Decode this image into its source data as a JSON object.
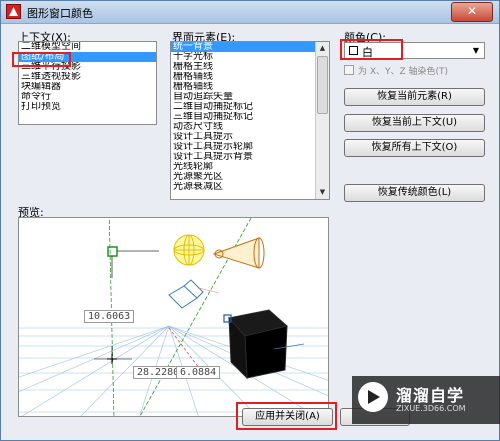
{
  "window": {
    "title": "图形窗口颜色",
    "close_label": "✕"
  },
  "context": {
    "label": "上下文(X):",
    "items": [
      "二维模型空间",
      "图纸/布局",
      "三维平行投影",
      "三维透视投影",
      "块编辑器",
      "命令行",
      "打印预览"
    ],
    "selected": 1
  },
  "elements": {
    "label": "界面元素(E):",
    "items": [
      "统一背景",
      "十字光标",
      "栅格主线",
      "栅格辅线",
      "栅格轴线",
      "自动追踪矢量",
      "二维自动捕捉标记",
      "三维自动捕捉标记",
      "动态尺寸线",
      "设计工具提示",
      "设计工具提示轮廓",
      "设计工具提示背景",
      "光线轮廓",
      "光源聚光区",
      "光源衰减区"
    ],
    "selected": 0
  },
  "color": {
    "label": "颜色(C):",
    "value": "白",
    "swatch": "#ffffff",
    "tint_label": "为 X、Y、Z 轴染色(T)"
  },
  "buttons": {
    "restore_element": "恢复当前元素(R)",
    "restore_context": "恢复当前上下文(U)",
    "restore_all": "恢复所有上下文(O)",
    "restore_classic": "恢复传统颜色(L)",
    "apply_close": "应用并关闭(A)"
  },
  "preview": {
    "label": "预览:",
    "coords": [
      "10.6063",
      "28.2280",
      "6.0884"
    ]
  },
  "watermark": {
    "name": "溜溜自学",
    "url": "ZIXUE.3D66.COM"
  },
  "highlight_color": "#e02020"
}
